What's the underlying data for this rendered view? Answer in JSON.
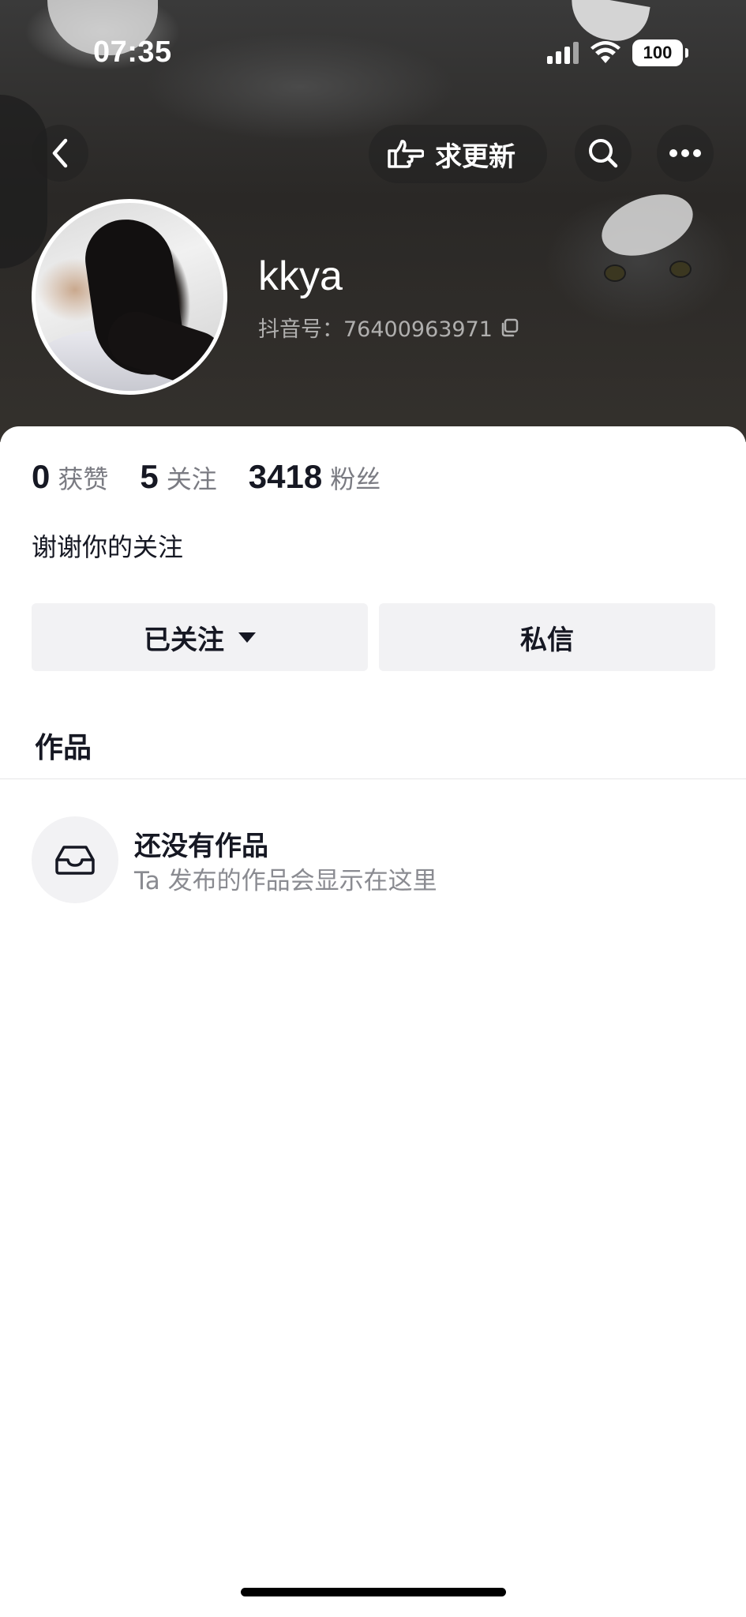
{
  "status_bar": {
    "time": "07:35",
    "battery": "100"
  },
  "header": {
    "request_update_label": "求更新",
    "username": "kkya",
    "douyin_id": "抖音号：76400963971"
  },
  "stats": [
    {
      "value": "0",
      "label": "获赞"
    },
    {
      "value": "5",
      "label": "关注"
    },
    {
      "value": "3418",
      "label": "粉丝"
    }
  ],
  "bio": "谢谢你的关注",
  "actions": {
    "follow_label": "已关注",
    "message_label": "私信"
  },
  "tabs": {
    "works_label": "作品"
  },
  "empty_state": {
    "title": "还没有作品",
    "subtitle": "Ta 发布的作品会显示在这里"
  },
  "icons": {
    "back": "chevron-left-icon",
    "search": "search-icon",
    "more": "more-icon",
    "update": "pointing-hand-icon",
    "copy": "copy-icon",
    "empty": "inbox-icon"
  }
}
